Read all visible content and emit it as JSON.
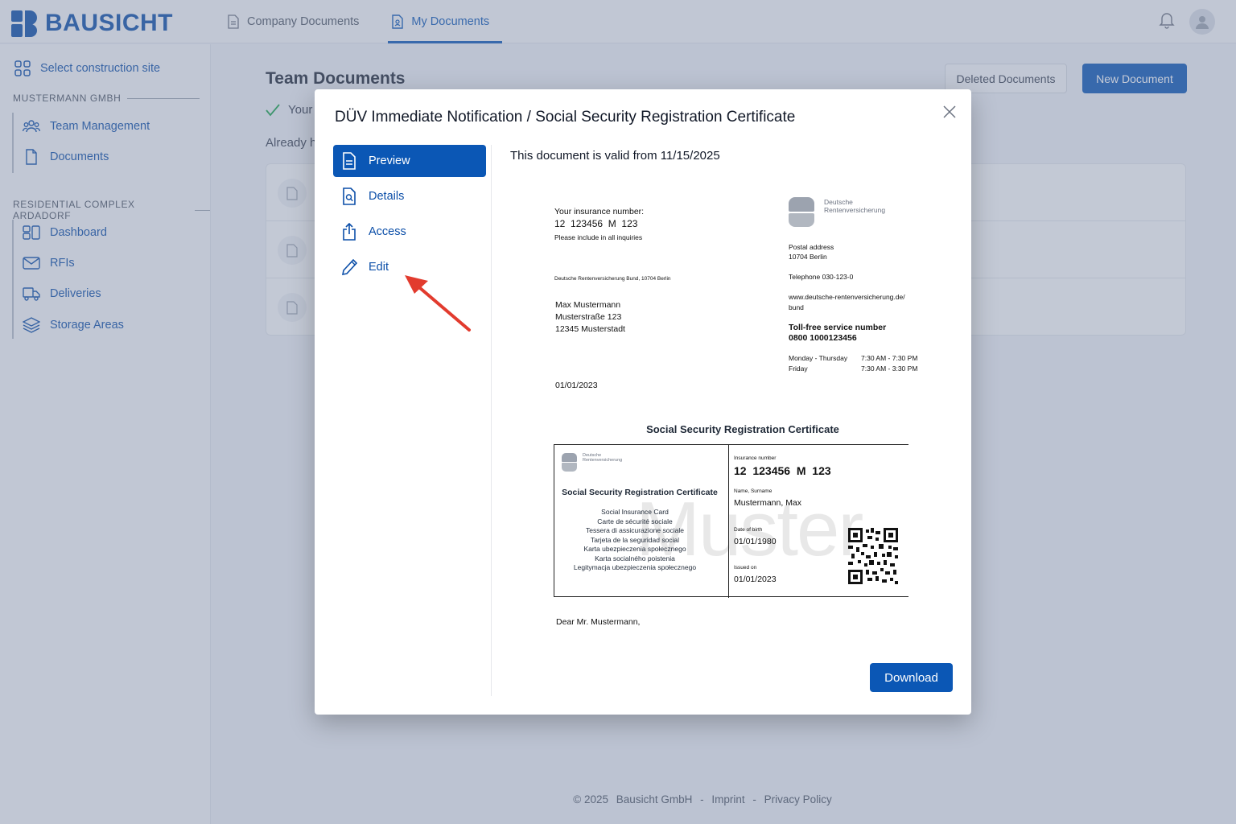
{
  "app": {
    "name": "BAUSICHT"
  },
  "header": {
    "tabs": [
      {
        "label": "Company Documents",
        "active": false
      },
      {
        "label": "My Documents",
        "active": true
      }
    ]
  },
  "sidebar": {
    "site_select": "Select construction site",
    "groups": [
      {
        "label": "MUSTERMANN GMBH",
        "items": [
          "Team Management",
          "Documents"
        ]
      },
      {
        "label": "RESIDENTIAL COMPLEX ARDADORF",
        "items": [
          "Dashboard",
          "RFIs",
          "Deliveries",
          "Storage Areas"
        ]
      }
    ]
  },
  "main": {
    "title": "Team Documents",
    "deleted_button": "Deleted Documents",
    "new_button": "New Document",
    "status_text": "Your",
    "already_text": "Already h"
  },
  "modal": {
    "title": "DÜV Immediate Notification / Social Security Registration Certificate",
    "nav": [
      {
        "label": "Preview",
        "icon": "document-icon",
        "active": true
      },
      {
        "label": "Details",
        "icon": "document-search-icon",
        "active": false
      },
      {
        "label": "Access",
        "icon": "share-icon",
        "active": false
      },
      {
        "label": "Edit",
        "icon": "pencil-icon",
        "active": false
      }
    ],
    "valid_text": "This document is valid from 11/15/2025",
    "download_button": "Download"
  },
  "document": {
    "insurance_label": "Your insurance number:",
    "insurance_number": "12  123456  M  123",
    "include_note": "Please include in all inquiries",
    "sender_line": "Deutsche Rentenversicherung Bund, 10704 Berlin",
    "recipient": [
      "Max Mustermann",
      "Musterstraße 123",
      "12345 Musterstadt"
    ],
    "letter_date": "01/01/2023",
    "org_name": [
      "Deutsche",
      "Rentenversicherung"
    ],
    "postal_label": "Postal address",
    "postal_city": "10704 Berlin",
    "telephone": "Telephone 030-123-0",
    "website": [
      "www.deutsche-rentenversicherung.de/",
      "bund"
    ],
    "tollfree_label": "Toll-free service number",
    "tollfree_number": "0800 1000123456",
    "hours": [
      {
        "days": "Monday - Thursday",
        "time": "7:30 AM - 7:30 PM"
      },
      {
        "days": "Friday",
        "time": "7:30 AM - 3:30 PM"
      }
    ],
    "certificate_heading": "Social Security Registration Certificate",
    "card": {
      "title": "Social Security Registration Certificate",
      "lines": [
        "Social Insurance Card",
        "Carte de sécurité sociale",
        "Tessera di assicurazione sociale",
        "Tarjeta de la seguridad social",
        "Karta ubezpieczenia społecznego",
        "Karta socialného poistenia",
        "Legitymacja ubezpieczenia społecznego"
      ],
      "insurance_label": "Insurance number",
      "insurance_number": "12  123456  M  123",
      "name_label": "Name, Surname",
      "name": "Mustermann, Max",
      "dob_label": "Date of birth",
      "dob": "01/01/1980",
      "issued_label": "Issued on",
      "issued": "01/01/2023",
      "watermark": "Muster"
    },
    "salutation": "Dear Mr. Mustermann,"
  },
  "footer": {
    "copyright": "© 2025",
    "company": "Bausicht GmbH",
    "sep": "-",
    "imprint": "Imprint",
    "privacy": "Privacy Policy"
  },
  "colors": {
    "primary": "#0b57b5",
    "brand": "#0b4ea8",
    "annotation": "#e23b2e"
  }
}
